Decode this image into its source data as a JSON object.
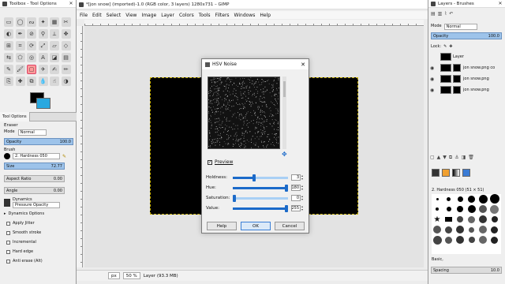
{
  "toolbox": {
    "title": "Toolbox - Tool Options",
    "tab_label": "Tool Options",
    "header": "Eraser",
    "mode_label": "Mode",
    "mode_value": "Normal",
    "opacity_label": "Opacity",
    "opacity_value": "100.0",
    "brush_label": "Brush",
    "brush_value": "2. Hardness 050",
    "size_label": "Size",
    "size_value": "72.77",
    "aspect_label": "Aspect Ratio",
    "aspect_value": "0.00",
    "angle_label": "Angle",
    "angle_value": "0.00",
    "dynamics_label": "Dynamics",
    "dynamics_value": "Pressure Opacity",
    "dynamics_options_label": "Dynamics Options",
    "checks": [
      "Apply Jitter",
      "Smooth stroke",
      "Incremental",
      "Hard edge",
      "Anti erase  (Alt)"
    ]
  },
  "image_window": {
    "title": "*[jon snow] (imported)-1.0 (RGB color, 3 layers) 1280x731 – GIMP",
    "menu": [
      "File",
      "Edit",
      "Select",
      "View",
      "Image",
      "Layer",
      "Colors",
      "Tools",
      "Filters",
      "Windows",
      "Help"
    ],
    "unit": "px",
    "zoom": "50 %",
    "status": "Layer (93.3 MB)"
  },
  "dialog": {
    "title": "HSV Noise",
    "preview_label": "Preview",
    "params": [
      {
        "label": "Holdness:",
        "value": "3",
        "fraction": 0.38
      },
      {
        "label": "Hue:",
        "value": "180",
        "fraction": 1.0
      },
      {
        "label": "Saturation:",
        "value": "0",
        "fraction": 0.0
      },
      {
        "label": "Value:",
        "value": "255",
        "fraction": 1.0
      }
    ],
    "buttons": {
      "help": "Help",
      "ok": "OK",
      "cancel": "Cancel"
    }
  },
  "dock": {
    "title": "Layers - Brushes",
    "mode_label": "Mode",
    "mode_value": "Normal",
    "opacity_label": "Opacity",
    "opacity_value": "100.0",
    "lock_label": "Lock:",
    "layers": [
      {
        "name": "Layer"
      },
      {
        "name": "jon snow.png co"
      },
      {
        "name": "jon snow.png"
      },
      {
        "name": "jon snow.png"
      }
    ],
    "brush_name": "2. Hardness 050 (51 × 51)",
    "basic_label": "Basic,",
    "spacing_label": "Spacing",
    "spacing_value": "10.0"
  }
}
